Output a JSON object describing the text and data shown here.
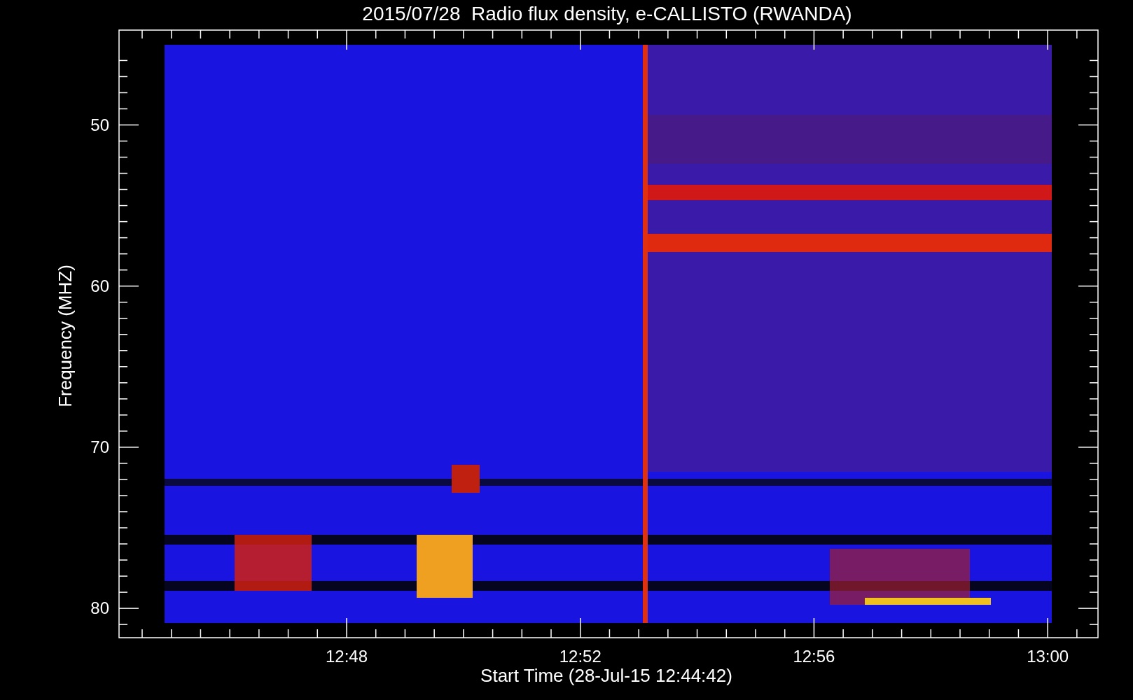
{
  "title": "2015/07/28  Radio flux density, e-CALLISTO (RWANDA)",
  "ylabel": "Frequency (MHZ)",
  "xlabel": "Start Time (28-Jul-15 12:44:42)",
  "yticks": [
    "50",
    "60",
    "70",
    "80"
  ],
  "xticks": [
    "12:48",
    "12:52",
    "12:56",
    "13:00"
  ]
}
